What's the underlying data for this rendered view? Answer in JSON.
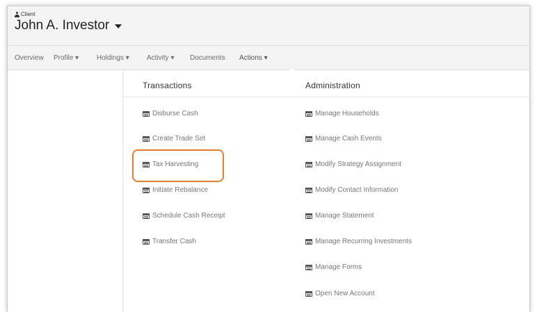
{
  "header": {
    "client_label": "Client",
    "client_name": "John A. Investor",
    "client_icon": "person-icon",
    "dropdown_icon": "caret-down-icon"
  },
  "nav": {
    "items": [
      {
        "label": "Overview"
      },
      {
        "label": "Profile ▾"
      },
      {
        "label": "Holdings ▾"
      },
      {
        "label": "Activity ▾"
      },
      {
        "label": "Documents"
      },
      {
        "label": "Actions ▾"
      }
    ],
    "active": "Actions ▾"
  },
  "menu": {
    "transactions": {
      "title": "Transactions",
      "items": [
        {
          "label": "Disburse Cash"
        },
        {
          "label": "Create Trade Set"
        },
        {
          "label": "Tax Harvesting"
        },
        {
          "label": "Initiate Rebalance"
        },
        {
          "label": "Schedule Cash Receipt"
        },
        {
          "label": "Transfer Cash"
        }
      ]
    },
    "administration": {
      "title": "Administration",
      "items": [
        {
          "label": "Manage Households"
        },
        {
          "label": "Manage Cash Events"
        },
        {
          "label": "Modify Strategy Assignment"
        },
        {
          "label": "Modify Contact Information"
        },
        {
          "label": "Manage Statement"
        },
        {
          "label": "Manage Recurring Investments"
        },
        {
          "label": "Manage Forms"
        },
        {
          "label": "Open New Account"
        }
      ]
    },
    "item_icon": "calendar-icon"
  },
  "colors": {
    "highlight_border": "#e87c2e",
    "header_bg": "#f4f4f4"
  }
}
